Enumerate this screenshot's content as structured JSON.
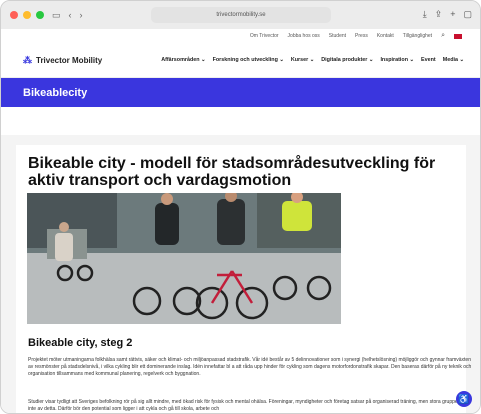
{
  "browser": {
    "url": "trivectormobility.se",
    "lights": [
      "#ff5f57",
      "#febc2e",
      "#28c840"
    ]
  },
  "site": {
    "utility_links": [
      "Om Trivector",
      "Jobba hos oss",
      "Student",
      "Press",
      "Kontakt",
      "Tillgänglighet"
    ],
    "logo_text": "Trivector Mobility",
    "nav": [
      {
        "label": "Affärsområden"
      },
      {
        "label": "Forskning och utveckling"
      },
      {
        "label": "Kurser"
      },
      {
        "label": "Digitala produkter"
      },
      {
        "label": "Inspiration"
      },
      {
        "label": "Event"
      },
      {
        "label": "Media"
      }
    ],
    "banner_title": "Bikeablecity",
    "page_title": "Bikeable city - modell för stadsområdesutveckling för aktiv transport och vardagsmotion",
    "section_title": "Bikeable city, steg 2",
    "paragraph_1": "Projektet möter utmaningarna folkhälsa samt rättvis, säker och klimat- och miljöanpassad stadstrafik. Vår idé består av 5 delinnovationer som i synergi (helhetslösning) möjliggör och gynnar framväxten av resmönster på stadsdelsnivå, i vilka cykling blir ett dominerande inslag. Idén innefattar bl a att råda upp hinder för cykling som dagens motorfordonstrafik skapar. Den baseras därför på ny teknik och organisation tillsammans med kommunal planering, regelverk och byggnation.",
    "paragraph_2": "Studier visar tydligt att Sveriges befolkning rör på sig allt mindre, med ökad risk för fysisk och mental ohälsa. Föreningar, myndigheter och företag satsar på organiserad träning, men stora grupper nås inte av detta. Därför bör den potential som ligger i att cykla och gå till skola, arbete och"
  },
  "colors": {
    "brand": "#3a36de"
  }
}
